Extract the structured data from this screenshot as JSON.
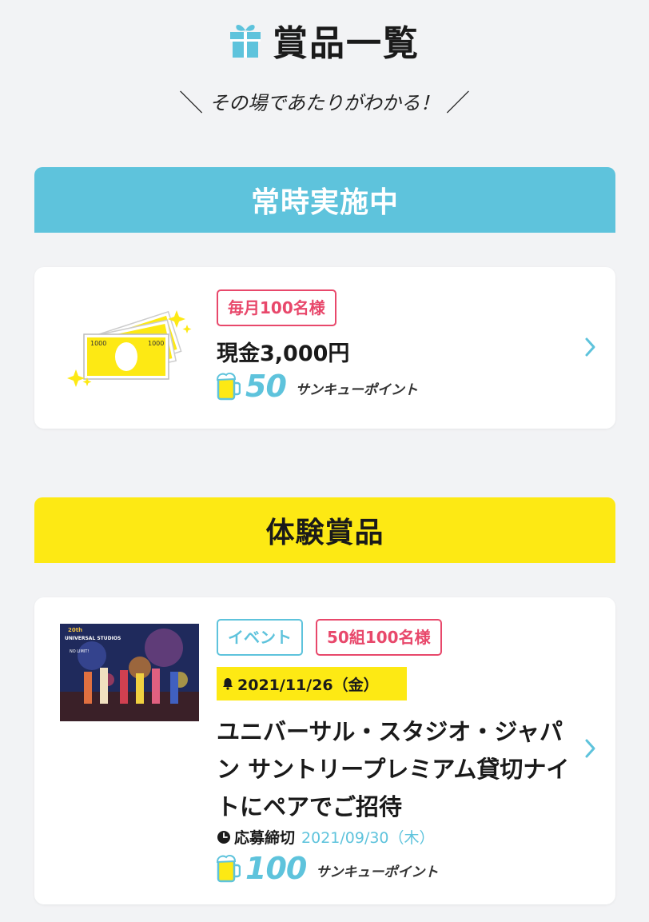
{
  "header": {
    "title": "賞品一覧",
    "subtitle": "その場であたりがわかる！"
  },
  "colors": {
    "accent_blue": "#5ec3dc",
    "accent_yellow": "#fde914",
    "accent_pink": "#e8486b",
    "background": "#f2f3f5"
  },
  "sections": [
    {
      "title": "常時実施中",
      "items": [
        {
          "tags": [
            "毎月100名様"
          ],
          "name": "現金3,000円",
          "points": "50",
          "points_unit": "サンキューポイント",
          "image": "cash-bills-image"
        }
      ]
    },
    {
      "title": "体験賞品",
      "items": [
        {
          "tags": [
            "イベント",
            "50組100名様"
          ],
          "event_date": "2021/11/26（金）",
          "name": "ユニバーサル・スタジオ・ジャパン サントリープレミアム貸切ナイトにペアでご招待",
          "deadline_label": "応募締切",
          "deadline_date": "2021/09/30（木）",
          "points": "100",
          "points_unit": "サンキューポイント",
          "image": "usj-event-photo"
        }
      ]
    }
  ]
}
